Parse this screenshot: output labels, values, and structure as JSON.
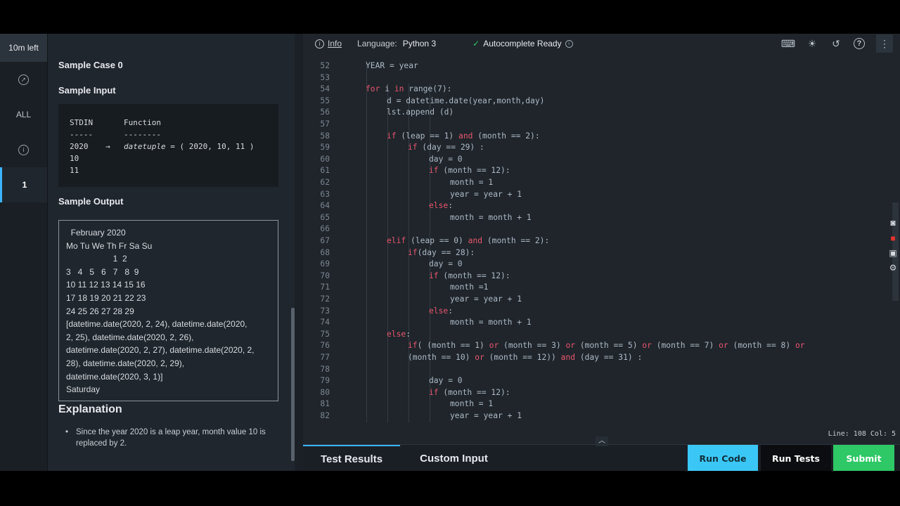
{
  "rail": {
    "timer": "10m left",
    "items": [
      {
        "icon": "compass-icon",
        "label": ""
      },
      {
        "icon": "",
        "label": "ALL"
      },
      {
        "icon": "info-icon",
        "label": ""
      },
      {
        "icon": "",
        "label": "1"
      }
    ]
  },
  "problem": {
    "sample_case": "Sample Case 0",
    "sample_input_heading": "Sample Input",
    "stdin_header": "STDIN",
    "stdin_dashes": "-----",
    "function_header": "Function",
    "function_dashes": "--------",
    "input_lines": [
      "2020",
      "10",
      "11"
    ],
    "arrow": "→",
    "function_call": "datetuple",
    "function_value": " = ( 2020, 10, 11 )",
    "sample_output_heading": "Sample Output",
    "output_lines": [
      "  February 2020",
      "Mo Tu We Th Fr Sa Su",
      "                    1  2",
      "3   4   5   6   7   8  9",
      "10 11 12 13 14 15 16",
      "17 18 19 20 21 22 23",
      "24 25 26 27 28 29",
      "[datetime.date(2020, 2, 24), datetime.date(2020,",
      "2, 25), datetime.date(2020, 2, 26),",
      "datetime.date(2020, 2, 27), datetime.date(2020, 2,",
      "28), datetime.date(2020, 2, 29),",
      "datetime.date(2020, 3, 1)]",
      "Saturday"
    ],
    "explanation_heading": "Explanation",
    "explanation_text": "Since the year 2020 is a leap year, month value 10 is replaced by 2."
  },
  "toolbar": {
    "info": "Info",
    "language_label": "Language:",
    "language_value": "Python 3",
    "autocomplete": "Autocomplete Ready",
    "status_check_color": "#36c26a"
  },
  "code": {
    "lines": [
      {
        "n": "52",
        "indent": 1,
        "text": "YEAR = year"
      },
      {
        "n": "53",
        "indent": 1,
        "text": ""
      },
      {
        "n": "54",
        "indent": 1,
        "text": "for i in range(7):"
      },
      {
        "n": "55",
        "indent": 2,
        "text": "d = datetime.date(year,month,day)"
      },
      {
        "n": "56",
        "indent": 2,
        "text": "lst.append (d)"
      },
      {
        "n": "57",
        "indent": 2,
        "text": ""
      },
      {
        "n": "58",
        "indent": 2,
        "text": "if (leap == 1) and (month == 2):"
      },
      {
        "n": "59",
        "indent": 3,
        "text": "if (day == 29) :"
      },
      {
        "n": "60",
        "indent": 4,
        "text": "day = 0"
      },
      {
        "n": "61",
        "indent": 4,
        "text": "if (month == 12):"
      },
      {
        "n": "62",
        "indent": 5,
        "text": "month = 1"
      },
      {
        "n": "63",
        "indent": 5,
        "text": "year = year + 1"
      },
      {
        "n": "64",
        "indent": 4,
        "text": "else:"
      },
      {
        "n": "65",
        "indent": 5,
        "text": "month = month + 1"
      },
      {
        "n": "66",
        "indent": 2,
        "text": ""
      },
      {
        "n": "67",
        "indent": 2,
        "text": "elif (leap == 0) and (month == 2):"
      },
      {
        "n": "68",
        "indent": 3,
        "text": "if(day == 28):"
      },
      {
        "n": "69",
        "indent": 4,
        "text": "day = 0"
      },
      {
        "n": "70",
        "indent": 4,
        "text": "if (month == 12):"
      },
      {
        "n": "71",
        "indent": 5,
        "text": "month =1"
      },
      {
        "n": "72",
        "indent": 5,
        "text": "year = year + 1"
      },
      {
        "n": "73",
        "indent": 4,
        "text": "else:"
      },
      {
        "n": "74",
        "indent": 5,
        "text": "month = month + 1"
      },
      {
        "n": "75",
        "indent": 2,
        "text": "else:"
      },
      {
        "n": "76",
        "indent": 3,
        "text": "if( (month == 1) or (month == 3) or (month == 5) or (month == 7) or (month == 8) or"
      },
      {
        "n": "77",
        "indent": 3,
        "text": "(month == 10) or (month == 12)) and (day == 31) :"
      },
      {
        "n": "78",
        "indent": 3,
        "text": ""
      },
      {
        "n": "79",
        "indent": 4,
        "text": "day = 0"
      },
      {
        "n": "80",
        "indent": 4,
        "text": "if (month == 12):"
      },
      {
        "n": "81",
        "indent": 5,
        "text": "month = 1"
      },
      {
        "n": "82",
        "indent": 5,
        "text": "year = year + 1"
      }
    ],
    "keywords": [
      "for",
      "in",
      "if",
      "elif",
      "else",
      "and",
      "or"
    ],
    "keyword_color": "#e8556d",
    "status": "Line: 108 Col: 5"
  },
  "bottom": {
    "tab_results": "Test Results",
    "tab_custom": "Custom Input",
    "run_code": "Run Code",
    "run_tests": "Run Tests",
    "submit": "Submit",
    "run_code_color": "#3bc7f5",
    "submit_color": "#2ec866"
  }
}
